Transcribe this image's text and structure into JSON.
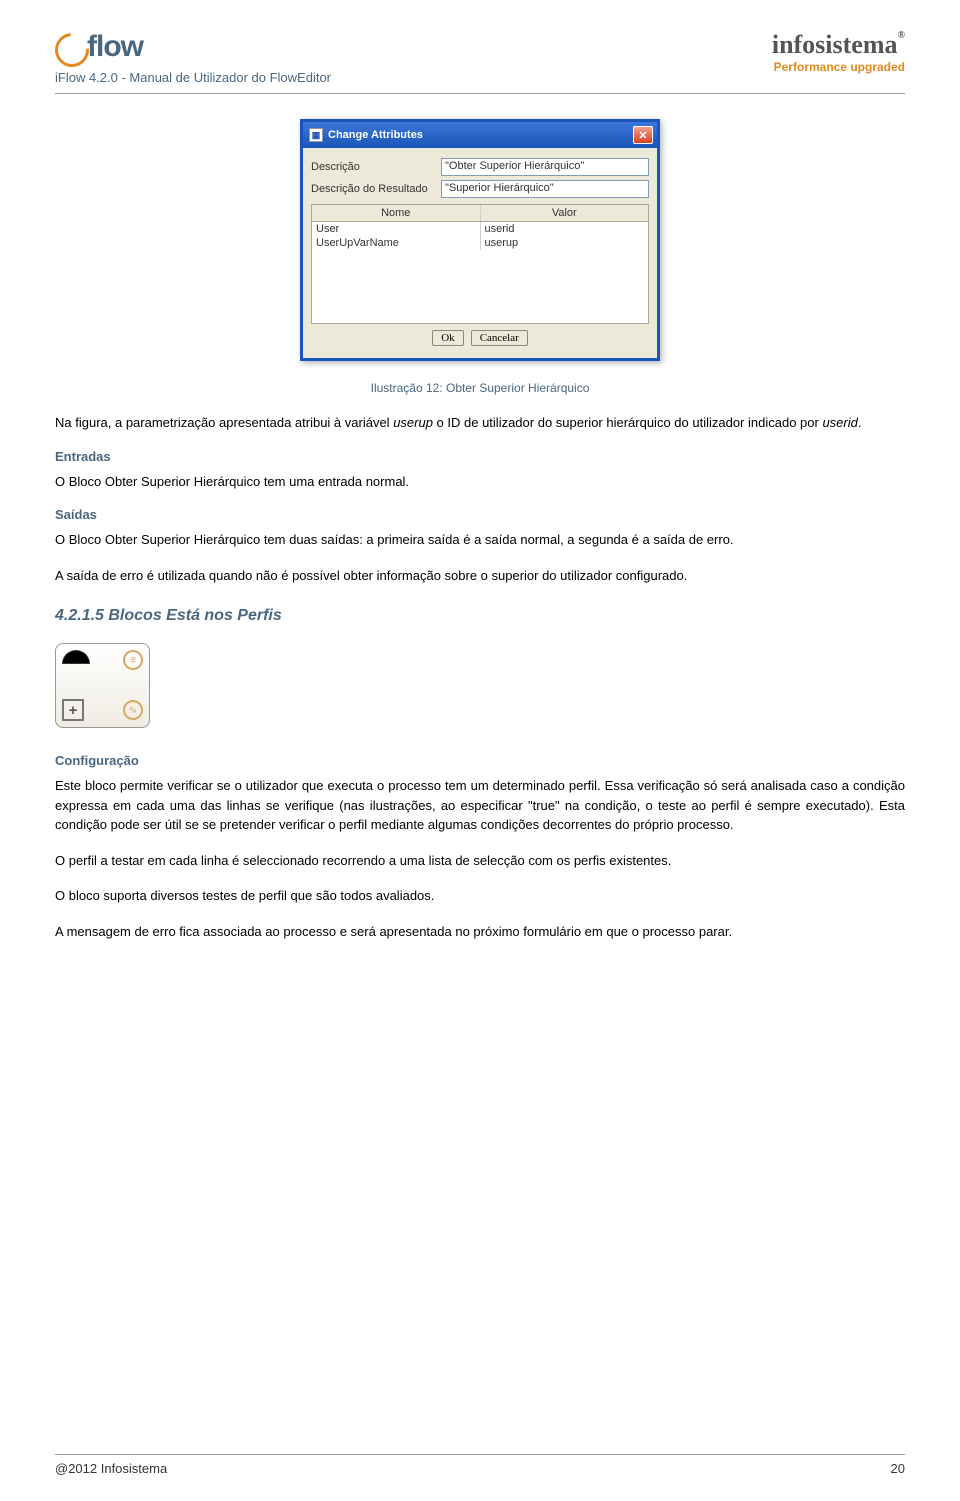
{
  "header": {
    "logo_text": "flow",
    "doc_title": "iFlow 4.2.0 - Manual de Utilizador do FlowEditor",
    "brand": "infosistema",
    "tagline": "Performance upgraded"
  },
  "dialog": {
    "title": "Change Attributes",
    "fields": {
      "descricao_label": "Descrição",
      "descricao_value": "\"Obter Superior Hierárquico\"",
      "resultado_label": "Descrição do Resultado",
      "resultado_value": "\"Superior Hierárquico\""
    },
    "table": {
      "col_nome": "Nome",
      "col_valor": "Valor",
      "rows": [
        {
          "nome": "User",
          "valor": "userid"
        },
        {
          "nome": "UserUpVarName",
          "valor": "userup"
        }
      ]
    },
    "buttons": {
      "ok": "Ok",
      "cancel": "Cancelar"
    }
  },
  "caption": "Ilustração 12: Obter Superior Hierárquico",
  "para_intro": "Na figura, a parametrização apresentada atribui à variável userup o ID de utilizador do superior hierárquico do utilizador indicado por userid.",
  "entradas_h": "Entradas",
  "entradas_p": "O Bloco Obter Superior Hierárquico tem uma entrada normal.",
  "saidas_h": "Saídas",
  "saidas_p1": "O Bloco Obter Superior Hierárquico tem duas saídas: a primeira saída é a saída normal, a segunda é a saída de erro.",
  "saidas_p2": "A saída de erro é utilizada quando não é possível obter informação sobre o superior do utilizador configurado.",
  "section_h": "4.2.1.5  Blocos Está nos Perfis",
  "config_h": "Configuração",
  "config_p1": "Este bloco permite verificar se o utilizador que executa o processo tem um determinado perfil. Essa verificação só será analisada caso a condição expressa em cada uma das linhas se verifique (nas ilustrações, ao especificar \"true\" na condição, o teste ao perfil é sempre executado). Esta condição pode ser útil se se pretender verificar o perfil mediante algumas condições decorrentes do próprio processo.",
  "config_p2": "O perfil a testar em cada linha é seleccionado recorrendo a uma lista de selecção com os perfis existentes.",
  "config_p3": "O bloco suporta diversos testes de perfil que são todos avaliados.",
  "config_p4": "A mensagem de erro fica associada ao processo e será apresentada no próximo formulário em que o processo parar.",
  "footer": {
    "left": "@2012 Infosistema",
    "right": "20"
  }
}
